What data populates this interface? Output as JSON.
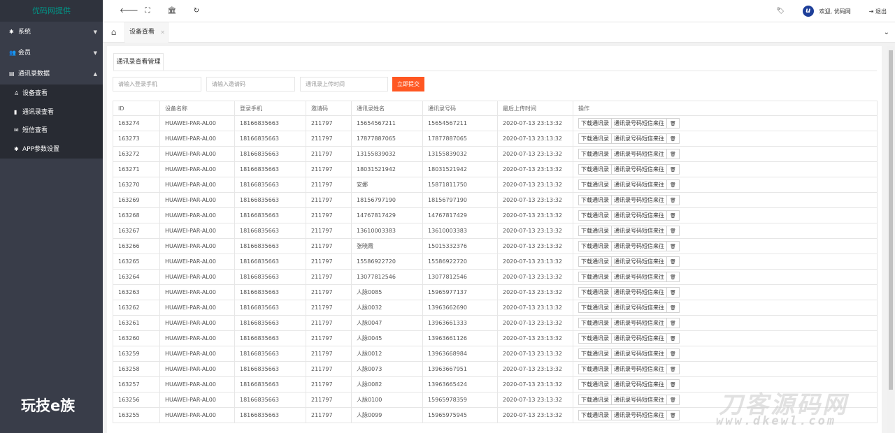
{
  "sidebar": {
    "logo": "优码网提供",
    "menus": [
      {
        "icon": "gear-icon",
        "glyph": "✱",
        "label": "系统",
        "expanded": false
      },
      {
        "icon": "users-icon",
        "glyph": "👥",
        "label": "会员",
        "expanded": false
      },
      {
        "icon": "contact-card-icon",
        "glyph": "▤",
        "label": "通讯录数据",
        "expanded": true
      }
    ],
    "submenu": [
      {
        "icon": "user-icon",
        "glyph": "♙",
        "label": "设备查看"
      },
      {
        "icon": "book-icon",
        "glyph": "▮",
        "label": "通讯录查看"
      },
      {
        "icon": "envelope-icon",
        "glyph": "✉",
        "label": "短信查看"
      },
      {
        "icon": "gear-icon",
        "glyph": "✱",
        "label": "APP参数设置"
      }
    ],
    "watermark": "玩技e族"
  },
  "header": {
    "welcome": "欢迎, 优码网",
    "logout": "退出",
    "avatar_letter": "u"
  },
  "tabs": {
    "active": "设备查看"
  },
  "main": {
    "tab_title": "通讯录查看管理",
    "search": {
      "phone_placeholder": "请输入登录手机",
      "invite_placeholder": "请输入邀请码",
      "time_placeholder": "通讯录上传时间",
      "submit": "立即提交"
    },
    "table": {
      "headers": [
        "ID",
        "设备名称",
        "登录手机",
        "邀请码",
        "通讯录姓名",
        "通讯录号码",
        "最后上传时间",
        "操作"
      ],
      "actions": [
        "下载通讯录",
        "通讯录号码短信来往",
        "🗑"
      ],
      "rows": [
        [
          "163274",
          "HUAWEI-PAR-AL00",
          "18166835663",
          "211797",
          "15654567211",
          "15654567211",
          "2020-07-13 23:13:32"
        ],
        [
          "163273",
          "HUAWEI-PAR-AL00",
          "18166835663",
          "211797",
          "17877887065",
          "17877887065",
          "2020-07-13 23:13:32"
        ],
        [
          "163272",
          "HUAWEI-PAR-AL00",
          "18166835663",
          "211797",
          "13155839032",
          "13155839032",
          "2020-07-13 23:13:32"
        ],
        [
          "163271",
          "HUAWEI-PAR-AL00",
          "18166835663",
          "211797",
          "18031521942",
          "18031521942",
          "2020-07-13 23:13:32"
        ],
        [
          "163270",
          "HUAWEI-PAR-AL00",
          "18166835663",
          "211797",
          "安娜",
          "15871811750",
          "2020-07-13 23:13:32"
        ],
        [
          "163269",
          "HUAWEI-PAR-AL00",
          "18166835663",
          "211797",
          "18156797190",
          "18156797190",
          "2020-07-13 23:13:32"
        ],
        [
          "163268",
          "HUAWEI-PAR-AL00",
          "18166835663",
          "211797",
          "14767817429",
          "14767817429",
          "2020-07-13 23:13:32"
        ],
        [
          "163267",
          "HUAWEI-PAR-AL00",
          "18166835663",
          "211797",
          "13610003383",
          "13610003383",
          "2020-07-13 23:13:32"
        ],
        [
          "163266",
          "HUAWEI-PAR-AL00",
          "18166835663",
          "211797",
          "张晓霞",
          "15015332376",
          "2020-07-13 23:13:32"
        ],
        [
          "163265",
          "HUAWEI-PAR-AL00",
          "18166835663",
          "211797",
          "15586922720",
          "15586922720",
          "2020-07-13 23:13:32"
        ],
        [
          "163264",
          "HUAWEI-PAR-AL00",
          "18166835663",
          "211797",
          "13077812546",
          "13077812546",
          "2020-07-13 23:13:32"
        ],
        [
          "163263",
          "HUAWEI-PAR-AL00",
          "18166835663",
          "211797",
          "人脉0085",
          "15965977137",
          "2020-07-13 23:13:32"
        ],
        [
          "163262",
          "HUAWEI-PAR-AL00",
          "18166835663",
          "211797",
          "人脉0032",
          "13963662690",
          "2020-07-13 23:13:32"
        ],
        [
          "163261",
          "HUAWEI-PAR-AL00",
          "18166835663",
          "211797",
          "人脉0047",
          "13963661333",
          "2020-07-13 23:13:32"
        ],
        [
          "163260",
          "HUAWEI-PAR-AL00",
          "18166835663",
          "211797",
          "人脉0045",
          "13963661126",
          "2020-07-13 23:13:32"
        ],
        [
          "163259",
          "HUAWEI-PAR-AL00",
          "18166835663",
          "211797",
          "人脉0012",
          "13963668984",
          "2020-07-13 23:13:32"
        ],
        [
          "163258",
          "HUAWEI-PAR-AL00",
          "18166835663",
          "211797",
          "人脉0073",
          "13963667951",
          "2020-07-13 23:13:32"
        ],
        [
          "163257",
          "HUAWEI-PAR-AL00",
          "18166835663",
          "211797",
          "人脉0082",
          "13963665424",
          "2020-07-13 23:13:32"
        ],
        [
          "163256",
          "HUAWEI-PAR-AL00",
          "18166835663",
          "211797",
          "人脉0100",
          "15965978359",
          "2020-07-13 23:13:32"
        ],
        [
          "163255",
          "HUAWEI-PAR-AL00",
          "18166835663",
          "211797",
          "人脉0099",
          "15965975945",
          "2020-07-13 23:13:32"
        ]
      ]
    }
  },
  "watermark": {
    "big": "刀客源码网",
    "small": "www.dkewl.com"
  }
}
